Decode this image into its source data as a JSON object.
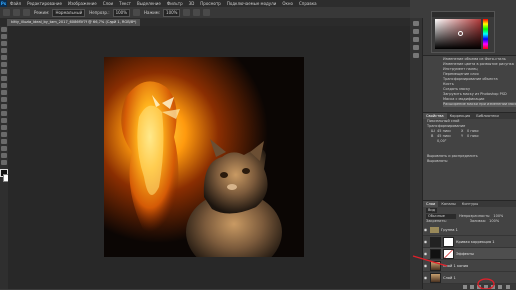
{
  "menubar": {
    "app_badge": "Ps",
    "items": [
      "Файл",
      "Редактирование",
      "Изображение",
      "Слои",
      "Текст",
      "Выделение",
      "Фильтр",
      "3D",
      "Просмотр",
      "Подключаемые модули",
      "Окно",
      "Справка"
    ]
  },
  "options": {
    "mode_label": "Режим:",
    "mode_value": "Нормальный",
    "opacity_label": "Непрозр.:",
    "opacity_value": "100%",
    "flow_label": "Нажим:",
    "flow_value": "100%"
  },
  "document": {
    "tab_title": "kitty_illuzia_ideal_by_tam_2017_6086f5f7f @ 66,7% (Слой 1, RGB/8*)",
    "close": "×"
  },
  "history": {
    "items": [
      "Изменение объема из Фото-стиль",
      "Изменение цвета в размытие рисунка",
      "Инструмент палец",
      "Перемещение слоя",
      "Трансформирование объекта",
      "Кисть",
      "Создать маску",
      "Загрузить маску из Photoshop PSD",
      "Маска с модификации",
      "Расширение маски при изменении маски"
    ]
  },
  "properties": {
    "tabs": [
      "Свойства",
      "Коррекция",
      "Библиотеки"
    ],
    "section1": "Пиксельный слой",
    "section2": "Трансформирование",
    "w_label": "Ш",
    "w_value": "45 пикс",
    "h_label": "В",
    "h_value": "45 пикс",
    "x_label": "X",
    "x_value": "0 пикс",
    "y_label": "Y",
    "y_value": "0 пикс",
    "angle": "0,00°",
    "section3": "Выровнять и распределить",
    "align_label": "Выровнять:"
  },
  "layers": {
    "tabs": [
      "Слои",
      "Каналы",
      "Контуры"
    ],
    "kind_label": "Вид",
    "blend": "Обычные",
    "opacity_label": "Непрозрачность:",
    "opacity_value": "100%",
    "lock_label": "Закрепить:",
    "fill_label": "Заливка:",
    "fill_value": "100%",
    "rows": [
      {
        "name": "Группа 1",
        "kind": "group"
      },
      {
        "name": "Кривая коррекция 1",
        "kind": "adjust"
      },
      {
        "name": "Эффекты",
        "kind": "fx"
      },
      {
        "name": "Слой 1 копия",
        "kind": "image"
      },
      {
        "name": "Слой 1",
        "kind": "image"
      }
    ]
  },
  "colors": {
    "highlight_circle": "#e0202a"
  }
}
